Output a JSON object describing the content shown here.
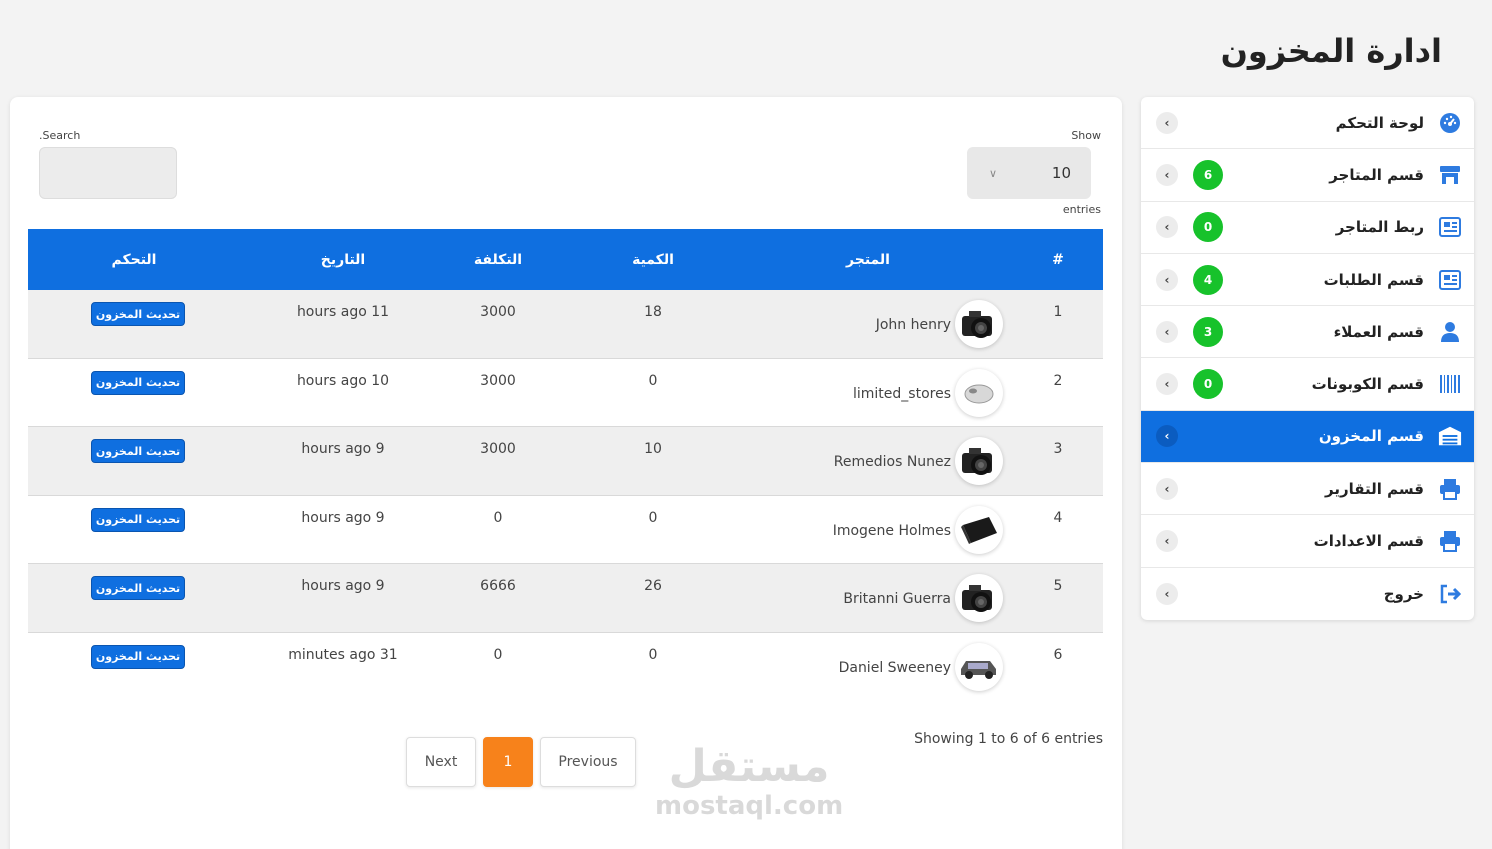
{
  "page": {
    "title": "ادارة المخزون"
  },
  "sidebar": {
    "items": [
      {
        "label": "لوحة التحكم",
        "icon": "dashboard-gauge-icon",
        "badge": ""
      },
      {
        "label": "قسم المتاجر",
        "icon": "store-icon",
        "badge": "6"
      },
      {
        "label": "ربط المتاجر",
        "icon": "newspaper-icon",
        "badge": "0"
      },
      {
        "label": "قسم الطلبات",
        "icon": "newspaper-icon",
        "badge": "4"
      },
      {
        "label": "قسم العملاء",
        "icon": "user-icon",
        "badge": "3"
      },
      {
        "label": "قسم الكوبونات",
        "icon": "barcode-icon",
        "badge": "0"
      },
      {
        "label": "قسم المخزون",
        "icon": "warehouse-icon",
        "badge": "",
        "active": true
      },
      {
        "label": "قسم التقارير",
        "icon": "printer-icon",
        "badge": ""
      },
      {
        "label": "قسم الاعدادات",
        "icon": "printer-icon",
        "badge": ""
      },
      {
        "label": "خروج",
        "icon": "sign-out-icon",
        "badge": ""
      }
    ]
  },
  "controls": {
    "show_label": "Show",
    "entries_label": "entries",
    "length_value": "10",
    "search_label": ".Search",
    "search_value": ""
  },
  "table": {
    "headers": {
      "num": "#",
      "store": "المتجر",
      "qty": "الكمية",
      "cost": "التكلفة",
      "date": "التاريخ",
      "control": "التحكم"
    },
    "rows": [
      {
        "num": "1",
        "store": "John henry",
        "thumb": "camera",
        "qty": "18",
        "cost": "3000",
        "date": "hours ago 11",
        "action": "تحديث المخزون"
      },
      {
        "num": "2",
        "store": "limited_stores",
        "thumb": "mouse",
        "qty": "0",
        "cost": "3000",
        "date": "hours ago 10",
        "action": "تحديث المخزون"
      },
      {
        "num": "3",
        "store": "Remedios Nunez",
        "thumb": "camera",
        "qty": "10",
        "cost": "3000",
        "date": "hours ago 9",
        "action": "تحديث المخزون"
      },
      {
        "num": "4",
        "store": "Imogene Holmes",
        "thumb": "console",
        "qty": "0",
        "cost": "0",
        "date": "hours ago 9",
        "action": "تحديث المخزون"
      },
      {
        "num": "5",
        "store": "Britanni Guerra",
        "thumb": "camera",
        "qty": "26",
        "cost": "6666",
        "date": "hours ago 9",
        "action": "تحديث المخزون"
      },
      {
        "num": "6",
        "store": "Daniel Sweeney",
        "thumb": "car",
        "qty": "0",
        "cost": "0",
        "date": "minutes ago 31",
        "action": "تحديث المخزون"
      }
    ]
  },
  "footer": {
    "showing": "Showing 1 to 6 of 6 entries",
    "next": "Next",
    "page": "1",
    "previous": "Previous"
  },
  "watermark": {
    "arabic": "مستقل",
    "latin": "mostaql.com"
  },
  "colors": {
    "primary": "#0f6fe0",
    "badge": "#17c22b",
    "page_active": "#f7821b"
  }
}
